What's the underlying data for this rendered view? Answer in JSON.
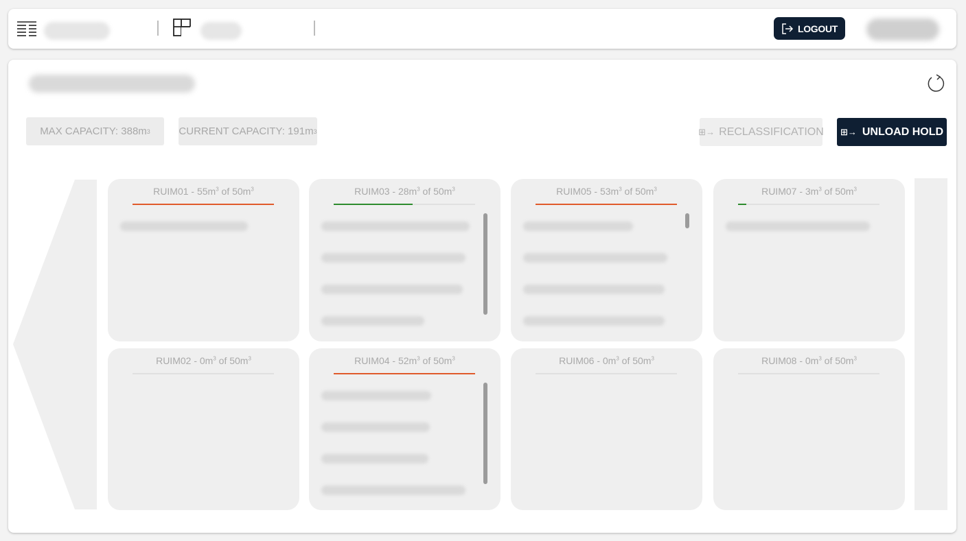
{
  "header": {
    "logout_label": "LOGOUT"
  },
  "capacity": {
    "max_label": "MAX CAPACITY: 388m",
    "current_label": "CURRENT CAPACITY: 191m",
    "unit_sup": "3"
  },
  "actions": {
    "reclassification_label": "RECLASSIFICATION",
    "unload_hold_label": "UNLOAD HOLD"
  },
  "holds": [
    {
      "name": "RUIM01",
      "title": "RUIM01 - 55m",
      "of": " of 50m",
      "sup": "3",
      "fill_ratio": 1.0,
      "bar_color": "#e05a2b",
      "cargo_count": 1,
      "scrollbar": "none"
    },
    {
      "name": "RUIM02",
      "title": "RUIM02 - 0m",
      "of": " of 50m",
      "sup": "3",
      "fill_ratio": 0.0,
      "bar_color": "#e05a2b",
      "cargo_count": 0,
      "scrollbar": "none"
    },
    {
      "name": "RUIM03",
      "title": "RUIM03 - 28m",
      "of": " of 50m",
      "sup": "3",
      "fill_ratio": 0.56,
      "bar_color": "#2e8b2e",
      "cargo_count": 4,
      "scrollbar": "tall"
    },
    {
      "name": "RUIM04",
      "title": "RUIM04 - 52m",
      "of": " of 50m",
      "sup": "3",
      "fill_ratio": 1.0,
      "bar_color": "#e05a2b",
      "cargo_count": 4,
      "scrollbar": "tall"
    },
    {
      "name": "RUIM05",
      "title": "RUIM05 - 53m",
      "of": " of 50m",
      "sup": "3",
      "fill_ratio": 1.0,
      "bar_color": "#e05a2b",
      "cargo_count": 4,
      "scrollbar": "short"
    },
    {
      "name": "RUIM06",
      "title": "RUIM06 - 0m",
      "of": " of 50m",
      "sup": "3",
      "fill_ratio": 0.0,
      "bar_color": "#e05a2b",
      "cargo_count": 0,
      "scrollbar": "none"
    },
    {
      "name": "RUIM07",
      "title": "RUIM07 - 3m",
      "of": " of 50m",
      "sup": "3",
      "fill_ratio": 0.06,
      "bar_color": "#2e8b2e",
      "cargo_count": 1,
      "scrollbar": "none"
    },
    {
      "name": "RUIM08",
      "title": "RUIM08 - 0m",
      "of": " of 50m",
      "sup": "3",
      "fill_ratio": 0.0,
      "bar_color": "#e05a2b",
      "cargo_count": 0,
      "scrollbar": "none"
    }
  ]
}
